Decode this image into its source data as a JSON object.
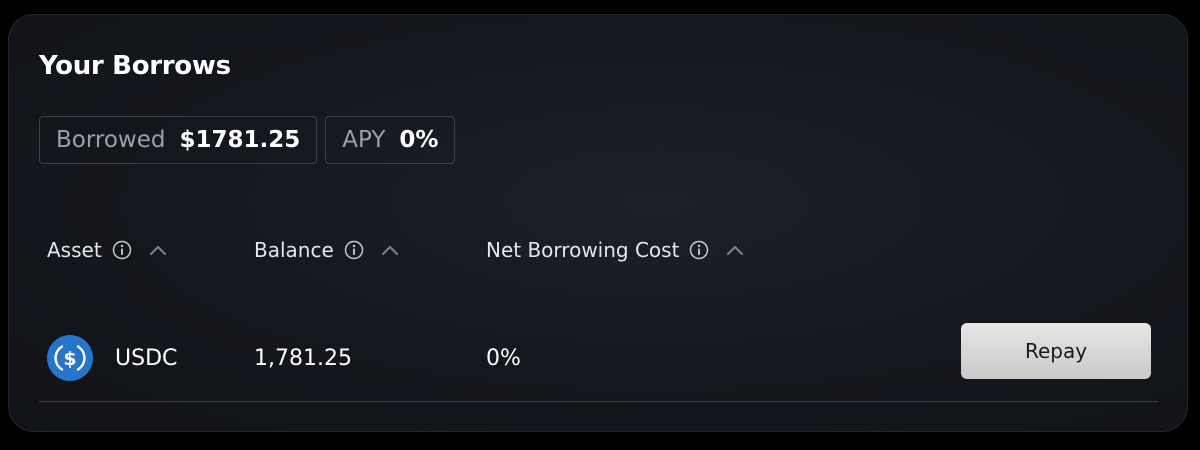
{
  "title": "Your Borrows",
  "summary": {
    "borrowed_label": "Borrowed",
    "borrowed_value": "$1781.25",
    "apy_label": "APY",
    "apy_value": "0%"
  },
  "table": {
    "headers": [
      {
        "label": "Asset",
        "icons": [
          "info-icon",
          "chevron-up-icon"
        ]
      },
      {
        "label": "Balance",
        "icons": [
          "info-icon",
          "chevron-up-icon"
        ]
      },
      {
        "label": "Net Borrowing Cost",
        "icons": [
          "info-icon",
          "chevron-up-icon"
        ]
      }
    ],
    "rows": [
      {
        "asset_icon": "usdc-icon",
        "asset": "USDC",
        "balance": "1,781.25",
        "net_borrowing_cost": "0%",
        "action_label": "Repay"
      }
    ]
  },
  "colors": {
    "panel_background": "#14171d",
    "border": "#3b3f47",
    "text_primary": "#ffffff",
    "text_muted": "#9ba0a8",
    "usdc_blue": "#2775ca",
    "button_background": "#d6d6d6"
  }
}
